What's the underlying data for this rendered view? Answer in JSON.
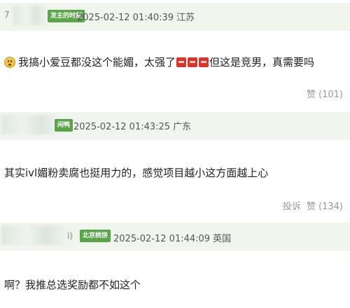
{
  "comments": [
    {
      "name_prefix": "7",
      "badge": "发主的时刻",
      "timestamp": "2025-02-12 01:40:39",
      "location": "江苏",
      "text_before": "我搞小爱豆都没这个能媚，太强了",
      "text_after": "但这是竞男，真需要吗",
      "likes_label": "赞 (101)"
    },
    {
      "badge": "闲鸭",
      "timestamp": "2025-02-12 01:43:25",
      "location": "广东",
      "text": "其实ivl媚粉卖腐也挺用力的，感觉项目越小这方面越上心",
      "report_label": "投诉",
      "likes_label": "赞 (134)"
    },
    {
      "name_suffix": "i)",
      "badge": "北京桃饼",
      "timestamp": "2025-02-12 01:44:09",
      "location": "英国",
      "text": "啊？我推总选奖励都不如这个"
    }
  ],
  "colors": {
    "badge_green": "#5aa54a",
    "header_band": "#f0f5ee",
    "emoji_red": "#d9362b"
  }
}
